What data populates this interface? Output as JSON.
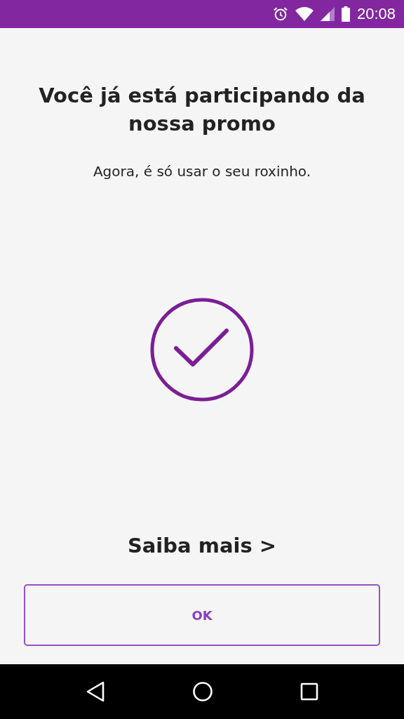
{
  "status_bar": {
    "time": "20:08"
  },
  "title": "Você já está participando da nossa promo",
  "subtitle": "Agora, é só usar o seu roxinho.",
  "learn_more_link": "Saiba mais >",
  "ok_button": "OK"
}
